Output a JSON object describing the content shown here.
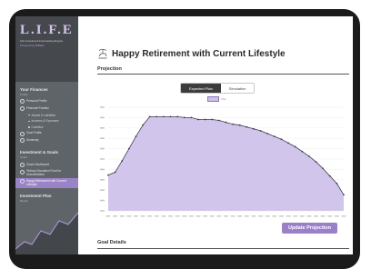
{
  "sidebar": {
    "logo": "L.I.F.E",
    "tagline": "Life Investment Forecasting Engine",
    "powered_by": "Powered by AllBank",
    "section1": {
      "title": "Your Finances",
      "subtitle": "Profile",
      "items": [
        {
          "label": "Personal Profile"
        },
        {
          "label": "Financial Position"
        },
        {
          "label": "Assets & Liabilities"
        },
        {
          "label": "Incomes & Expenses"
        },
        {
          "label": "Cashflow"
        },
        {
          "label": "Goal Profile"
        },
        {
          "label": "Summary"
        }
      ]
    },
    "section2": {
      "title": "Investment & Goals",
      "subtitle": "Goals",
      "items": [
        {
          "label": "Goals Dashboard"
        },
        {
          "label": "Tertiary Education Fund for Grandchildren"
        },
        {
          "label": "Happy Retirement with Current Lifestyle"
        }
      ]
    },
    "section3": {
      "title": "Investment Plan",
      "subtitle": "Report"
    }
  },
  "main": {
    "title": "Happy Retirement with Current Lifestyle",
    "title_icon": "beach-chair-icon",
    "projection_label": "Projection",
    "tabs": [
      {
        "label": "Expected Plan",
        "active": true
      },
      {
        "label": "Simulation",
        "active": false
      }
    ],
    "legend_label": "Plan",
    "update_button": "Update Projection",
    "goal_details_label": "Goal Details"
  },
  "colors": {
    "accent": "#9a80c8",
    "area_fill": "#cdbfea",
    "line": "#3e3e52",
    "sidebar": "#5f6468"
  },
  "chart_data": {
    "type": "area",
    "x": [
      1,
      2,
      3,
      4,
      5,
      6,
      7,
      8,
      9,
      10,
      11,
      12,
      13,
      14,
      15,
      16,
      17,
      18,
      19,
      20,
      21,
      22,
      23,
      24,
      25,
      26,
      27,
      28,
      29,
      30,
      31,
      32,
      33,
      34,
      35
    ],
    "series": [
      {
        "values": [
          38,
          41,
          53,
          66,
          79,
          91,
          100,
          100,
          100,
          100,
          100,
          99,
          99,
          97,
          97,
          97,
          96,
          94,
          92,
          91,
          89,
          87,
          85,
          82,
          79,
          76,
          72,
          68,
          63,
          58,
          52,
          45,
          37,
          29,
          17
        ]
      }
    ],
    "ylim": [
      0,
      110
    ],
    "grid": true,
    "xlabel": "",
    "ylabel": ""
  }
}
